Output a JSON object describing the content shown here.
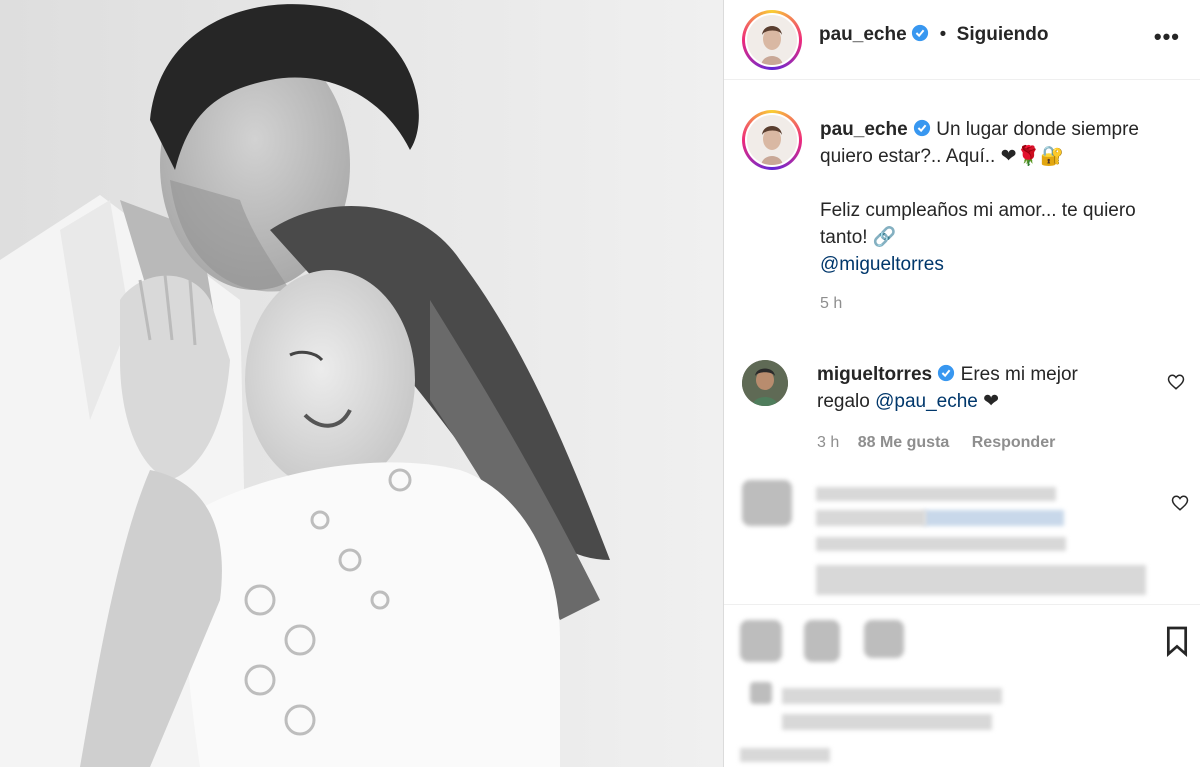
{
  "photo": {
    "description_icon": "couple-photo"
  },
  "header": {
    "username": "pau_eche",
    "separator": "•",
    "follow_status": "Siguiendo",
    "more_icon": "ellipsis-icon",
    "more_label": "•••"
  },
  "caption": {
    "username": "pau_eche",
    "line1": "Un lugar donde siempre",
    "line2": "quiero estar?.. Aquí.. ❤🌹🔐",
    "line3": "Feliz cumpleaños mi amor... te quiero",
    "line4": "tanto! 🔗",
    "mention": "@migueltorres",
    "time": "5 h"
  },
  "comment": {
    "username": "migueltorres",
    "text1": "Eres mi mejor",
    "text2_prefix": "regalo ",
    "mention": "@pau_eche",
    "text2_suffix": " ❤",
    "time": "3 h",
    "likes": "88 Me gusta",
    "reply": "Responder"
  },
  "colors": {
    "verified": "#3897f0",
    "mention": "#00376b",
    "meta": "#8e8e8e"
  }
}
